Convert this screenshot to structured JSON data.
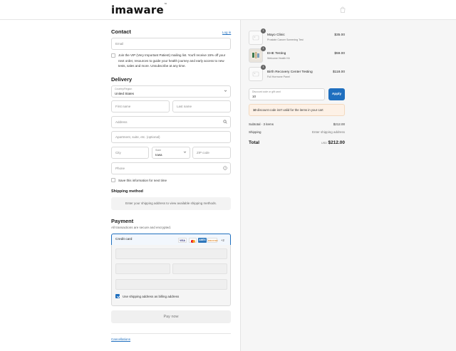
{
  "header": {
    "logo_text": "imaware",
    "logo_mark": "™"
  },
  "contact": {
    "title": "Contact",
    "login_link": "Log in",
    "email_placeholder": "Email",
    "vip_text": "Join the VIP (Very Important Patient) mailing list. You'll receive 15% off your next order, resources to guide your health journey and early access to new tests, sales and more. Unsubscribe at any time."
  },
  "delivery": {
    "title": "Delivery",
    "country_label": "Country/Region",
    "country_value": "United States",
    "first_name_placeholder": "First name",
    "last_name_placeholder": "Last name",
    "address_placeholder": "Address",
    "apartment_placeholder": "Apartment, suite, etc. (optional)",
    "city_placeholder": "City",
    "state_label": "State",
    "state_value": "Iowa",
    "zip_placeholder": "ZIP code",
    "phone_placeholder": "Phone",
    "save_info_label": "Save this information for next time"
  },
  "shipping_method": {
    "title": "Shipping method",
    "notice": "Enter your shipping address to view available shipping methods."
  },
  "payment": {
    "title": "Payment",
    "subtitle": "All transactions are secure and encrypted.",
    "credit_card_label": "Credit card",
    "brands": [
      "VISA",
      "MC",
      "AMEX",
      "DISCOVER"
    ],
    "more_brands": "+2",
    "billing_same_label": "Use shipping address as billing address",
    "pay_button": "Pay now"
  },
  "footer": {
    "cancellations_link": "Cancellations"
  },
  "order": {
    "items": [
      {
        "badge": "1",
        "name": "Mayo Clinic",
        "subtitle": "Prostate Cancer Screening Test",
        "price": "$35.00"
      },
      {
        "badge": "1",
        "name": "EHE Testing",
        "subtitle": "Welcome Health Kit",
        "price": "$59.00"
      },
      {
        "badge": "1",
        "name": "Birth Recovery Center Testing",
        "subtitle": "Full Hormone Panel",
        "price": "$118.00"
      }
    ],
    "discount_label": "Discount code or gift card",
    "discount_value": "10",
    "apply_button": "Apply",
    "error_code": "10",
    "error_text": "discount code isn't valid for the items in your cart",
    "subtotal_label": "Subtotal · 3 items",
    "subtotal_value": "$212.00",
    "shipping_label": "Shipping",
    "shipping_value": "Enter shipping address",
    "total_label": "Total",
    "currency": "USD",
    "total_value": "$212.00"
  },
  "colors": {
    "accent": "#1f6fbf",
    "error_bg": "#fdf1e6"
  }
}
